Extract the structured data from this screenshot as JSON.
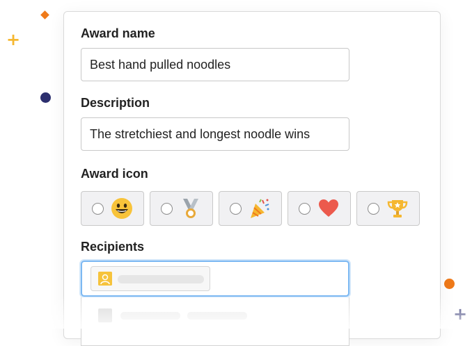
{
  "form": {
    "award_name_label": "Award name",
    "award_name_value": "Best hand pulled noodles",
    "description_label": "Description",
    "description_value": "The stretchiest and longest noodle wins",
    "award_icon_label": "Award icon",
    "award_icon_options": [
      {
        "icon": "smiley-face-icon",
        "selected": false
      },
      {
        "icon": "medal-icon",
        "selected": false
      },
      {
        "icon": "party-popper-icon",
        "selected": false
      },
      {
        "icon": "heart-icon",
        "selected": false
      },
      {
        "icon": "trophy-icon",
        "selected": false
      }
    ],
    "recipients_label": "Recipients"
  },
  "colors": {
    "accent_focus": "#7cb8f2",
    "deco_orange": "#ef7a1a",
    "deco_yellow": "#f5b730",
    "deco_navy": "#2c2f6e"
  }
}
